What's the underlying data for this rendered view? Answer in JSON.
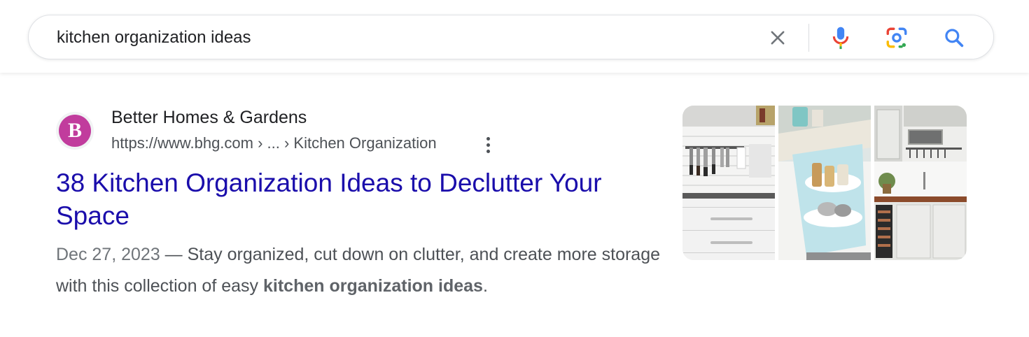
{
  "search": {
    "query": "kitchen organization ideas"
  },
  "icons": {
    "clear": "close-icon",
    "mic": "microphone-icon",
    "lens": "camera-lens-icon",
    "search": "search-icon",
    "more": "more-vert-icon"
  },
  "colors": {
    "link": "#1a0dab",
    "favicon": "#c13c9d",
    "mic_blue": "#4285f4",
    "mic_red": "#ea4335",
    "mic_yellow": "#fbbc04",
    "mic_green": "#34a853"
  },
  "result": {
    "favicon_letter": "B",
    "site_name": "Better Homes & Gardens",
    "url": "https://www.bhg.com › ... › Kitchen Organization",
    "title": "38 Kitchen Organization Ideas to Declutter Your Space",
    "date": "Dec 27, 2023",
    "separator": " — ",
    "snippet_text": "Stay organized, cut down on clutter, and create more storage with this collection of easy ",
    "snippet_bold": "kitchen organization ideas",
    "snippet_end": "."
  }
}
